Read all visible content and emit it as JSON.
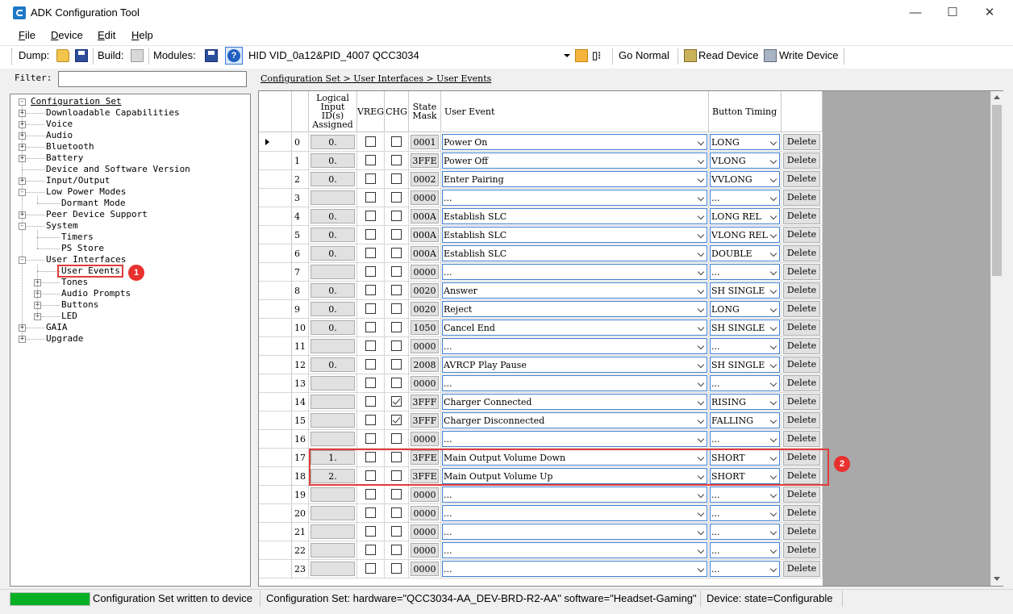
{
  "window": {
    "title": "ADK Configuration Tool",
    "minimize": "—",
    "maximize": "☐",
    "close": "✕"
  },
  "menu": [
    "File",
    "Device",
    "Edit",
    "Help"
  ],
  "toolbar": {
    "dump_label": "Dump:",
    "build_label": "Build:",
    "modules_label": "Modules:",
    "device": "HID VID_0a12&PID_4007 QCC3034",
    "go_normal": "Go Normal",
    "read_device": "Read Device",
    "write_device": "Write Device"
  },
  "filter": {
    "label": "Filter:",
    "value": ""
  },
  "breadcrumb": "Configuration Set > User Interfaces > User Events",
  "tree": {
    "root": "Configuration Set",
    "items": [
      {
        "label": "Downloadable Capabilities",
        "level": 1,
        "exp": "+"
      },
      {
        "label": "Voice",
        "level": 1,
        "exp": "+"
      },
      {
        "label": "Audio",
        "level": 1,
        "exp": "+"
      },
      {
        "label": "Bluetooth",
        "level": 1,
        "exp": "+"
      },
      {
        "label": "Battery",
        "level": 1,
        "exp": "+"
      },
      {
        "label": "Device and Software Version",
        "level": 1,
        "exp": ""
      },
      {
        "label": "Input/Output",
        "level": 1,
        "exp": "+"
      },
      {
        "label": "Low Power Modes",
        "level": 1,
        "exp": "-"
      },
      {
        "label": "Dormant Mode",
        "level": 2,
        "exp": ""
      },
      {
        "label": "Peer Device Support",
        "level": 1,
        "exp": "+"
      },
      {
        "label": "System",
        "level": 1,
        "exp": "-"
      },
      {
        "label": "Timers",
        "level": 2,
        "exp": ""
      },
      {
        "label": "PS Store",
        "level": 2,
        "exp": ""
      },
      {
        "label": "User Interfaces",
        "level": 1,
        "exp": "-"
      },
      {
        "label": "User Events",
        "level": 2,
        "exp": "",
        "selected": true
      },
      {
        "label": "Tones",
        "level": 2,
        "exp": "+"
      },
      {
        "label": "Audio Prompts",
        "level": 2,
        "exp": "+"
      },
      {
        "label": "Buttons",
        "level": 2,
        "exp": "+"
      },
      {
        "label": "LED",
        "level": 2,
        "exp": "+"
      },
      {
        "label": "GAIA",
        "level": 1,
        "exp": "+"
      },
      {
        "label": "Upgrade",
        "level": 1,
        "exp": "+"
      }
    ]
  },
  "callouts": [
    "1",
    "2"
  ],
  "grid": {
    "headers": {
      "logical": [
        "Logical",
        "Input",
        "ID(s)",
        "Assigned"
      ],
      "vreg": "VREG",
      "chg": "CHG",
      "state": [
        "State",
        "Mask"
      ],
      "event": "User Event",
      "timing": "Button Timing"
    },
    "delete_label": "Delete",
    "rows": [
      {
        "idx": "0",
        "id": "0.",
        "vreg": false,
        "chg": false,
        "mask": "0001",
        "event": "Power On",
        "timing": "LONG"
      },
      {
        "idx": "1",
        "id": "0.",
        "vreg": false,
        "chg": false,
        "mask": "3FFE",
        "event": "Power Off",
        "timing": "VLONG"
      },
      {
        "idx": "2",
        "id": "0.",
        "vreg": false,
        "chg": false,
        "mask": "0002",
        "event": "Enter Pairing",
        "timing": "VVLONG"
      },
      {
        "idx": "3",
        "id": "",
        "vreg": false,
        "chg": false,
        "mask": "0000",
        "event": "...",
        "timing": "..."
      },
      {
        "idx": "4",
        "id": "0.",
        "vreg": false,
        "chg": false,
        "mask": "000A",
        "event": "Establish SLC",
        "timing": "LONG REL"
      },
      {
        "idx": "5",
        "id": "0.",
        "vreg": false,
        "chg": false,
        "mask": "000A",
        "event": "Establish SLC",
        "timing": "VLONG REL"
      },
      {
        "idx": "6",
        "id": "0.",
        "vreg": false,
        "chg": false,
        "mask": "000A",
        "event": "Establish SLC",
        "timing": "DOUBLE"
      },
      {
        "idx": "7",
        "id": "",
        "vreg": false,
        "chg": false,
        "mask": "0000",
        "event": "...",
        "timing": "..."
      },
      {
        "idx": "8",
        "id": "0.",
        "vreg": false,
        "chg": false,
        "mask": "0020",
        "event": "Answer",
        "timing": "SH SINGLE"
      },
      {
        "idx": "9",
        "id": "0.",
        "vreg": false,
        "chg": false,
        "mask": "0020",
        "event": "Reject",
        "timing": "LONG"
      },
      {
        "idx": "10",
        "id": "0.",
        "vreg": false,
        "chg": false,
        "mask": "1050",
        "event": "Cancel End",
        "timing": "SH SINGLE"
      },
      {
        "idx": "11",
        "id": "",
        "vreg": false,
        "chg": false,
        "mask": "0000",
        "event": "...",
        "timing": "..."
      },
      {
        "idx": "12",
        "id": "0.",
        "vreg": false,
        "chg": false,
        "mask": "2008",
        "event": "AVRCP Play Pause",
        "timing": "SH SINGLE"
      },
      {
        "idx": "13",
        "id": "",
        "vreg": false,
        "chg": false,
        "mask": "0000",
        "event": "...",
        "timing": "..."
      },
      {
        "idx": "14",
        "id": "",
        "vreg": false,
        "chg": true,
        "mask": "3FFF",
        "event": "Charger Connected",
        "timing": "RISING"
      },
      {
        "idx": "15",
        "id": "",
        "vreg": false,
        "chg": true,
        "mask": "3FFF",
        "event": "Charger Disconnected",
        "timing": "FALLING"
      },
      {
        "idx": "16",
        "id": "",
        "vreg": false,
        "chg": false,
        "mask": "0000",
        "event": "...",
        "timing": "..."
      },
      {
        "idx": "17",
        "id": "1.",
        "vreg": false,
        "chg": false,
        "mask": "3FFE",
        "event": "Main Output Volume Down",
        "timing": "SHORT"
      },
      {
        "idx": "18",
        "id": "2.",
        "vreg": false,
        "chg": false,
        "mask": "3FFE",
        "event": "Main Output Volume Up",
        "timing": "SHORT"
      },
      {
        "idx": "19",
        "id": "",
        "vreg": false,
        "chg": false,
        "mask": "0000",
        "event": "...",
        "timing": "..."
      },
      {
        "idx": "20",
        "id": "",
        "vreg": false,
        "chg": false,
        "mask": "0000",
        "event": "...",
        "timing": "..."
      },
      {
        "idx": "21",
        "id": "",
        "vreg": false,
        "chg": false,
        "mask": "0000",
        "event": "...",
        "timing": "..."
      },
      {
        "idx": "22",
        "id": "",
        "vreg": false,
        "chg": false,
        "mask": "0000",
        "event": "...",
        "timing": "..."
      },
      {
        "idx": "23",
        "id": "",
        "vreg": false,
        "chg": false,
        "mask": "0000",
        "event": "...",
        "timing": "..."
      }
    ]
  },
  "status": {
    "message": "Configuration Set written to device",
    "config": "Configuration Set:  hardware=\"QCC3034-AA_DEV-BRD-R2-AA\" software=\"Headset-Gaming\"",
    "device": "Device:  state=Configurable"
  }
}
